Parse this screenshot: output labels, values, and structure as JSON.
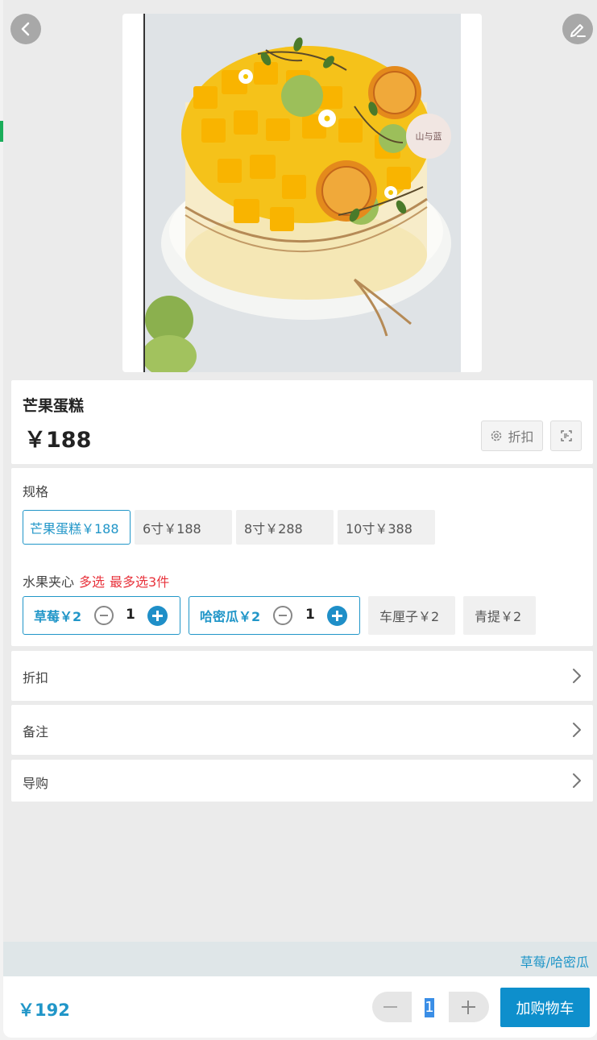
{
  "product": {
    "name": "芒果蛋糕",
    "price": "￥188",
    "discount_label": "折扣",
    "image_watermark": "山与蓝"
  },
  "spec": {
    "label": "规格",
    "options": [
      {
        "label": "芒果蛋糕￥188",
        "selected": true
      },
      {
        "label": "6寸￥188",
        "selected": false
      },
      {
        "label": "8寸￥288",
        "selected": false
      },
      {
        "label": "10寸￥388",
        "selected": false
      }
    ]
  },
  "fruit": {
    "label": "水果夹心",
    "tag_multi": "多选",
    "tag_max": "最多选3件",
    "options": [
      {
        "label": "草莓￥2",
        "qty": "1",
        "selected": true
      },
      {
        "label": "哈密瓜￥2",
        "qty": "1",
        "selected": true
      },
      {
        "label": "车厘子￥2",
        "selected": false
      },
      {
        "label": "青提￥2",
        "selected": false
      }
    ]
  },
  "rows": {
    "discount": "折扣",
    "note": "备注",
    "guide": "导购"
  },
  "summary": {
    "selected_fillings": "草莓/哈密瓜"
  },
  "footer": {
    "total_price": "￥192",
    "quantity": "1",
    "add_to_cart": "加购物车"
  },
  "colors": {
    "accent": "#2196c8",
    "warning": "#e8333c",
    "cart_button": "#0e8fcc"
  }
}
